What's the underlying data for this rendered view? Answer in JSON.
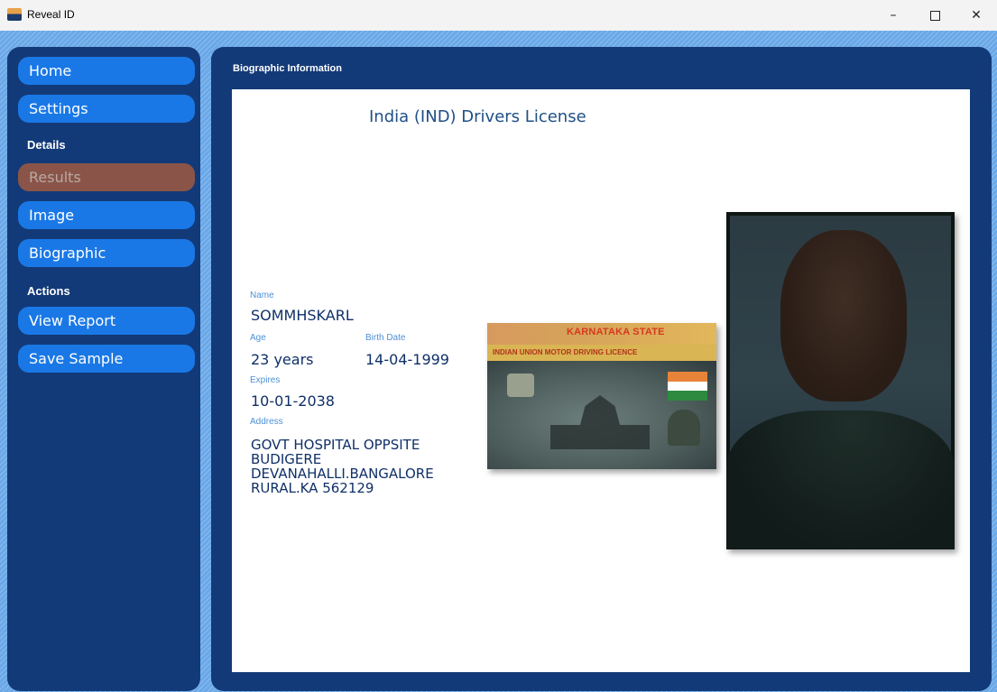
{
  "window": {
    "title": "Reveal ID",
    "minimize_glyph": "–",
    "close_glyph": "✕"
  },
  "sidebar": {
    "items": [
      {
        "label": "Home"
      },
      {
        "label": "Settings"
      },
      {
        "section": "Details"
      },
      {
        "label": "Results",
        "disabled": true
      },
      {
        "label": "Image"
      },
      {
        "label": "Biographic"
      },
      {
        "section": "Actions"
      },
      {
        "label": "View Report"
      },
      {
        "label": "Save Sample"
      }
    ]
  },
  "panel": {
    "title": "Biographic Information"
  },
  "document": {
    "title": "India (IND) Drivers License",
    "fields": {
      "name_label": "Name",
      "name_value": "SOMMHSKARL",
      "age_label": "Age",
      "age_value": "23 years",
      "birth_label": "Birth Date",
      "birth_value": "14-04-1999",
      "expires_label": "Expires",
      "expires_value": "10-01-2038",
      "address_label": "Address",
      "address_lines": [
        "GOVT HOSPITAL OPPSITE",
        "BUDIGERE",
        "DEVANAHALLI.BANGALORE",
        "RURAL.KA 562129"
      ]
    },
    "license_image": {
      "header_text": "KARNATAKA STATE",
      "band_text": "INDIAN UNION MOTOR DRIVING LICENCE",
      "flag_colors": [
        "#e8843a",
        "#ffffff",
        "#2d8a3e"
      ]
    }
  },
  "colors": {
    "nav_button": "#1a78e6",
    "nav_disabled": "#8a5548",
    "panel_bg": "#133a78",
    "label": "#4d90d6",
    "value": "#0f3068"
  }
}
